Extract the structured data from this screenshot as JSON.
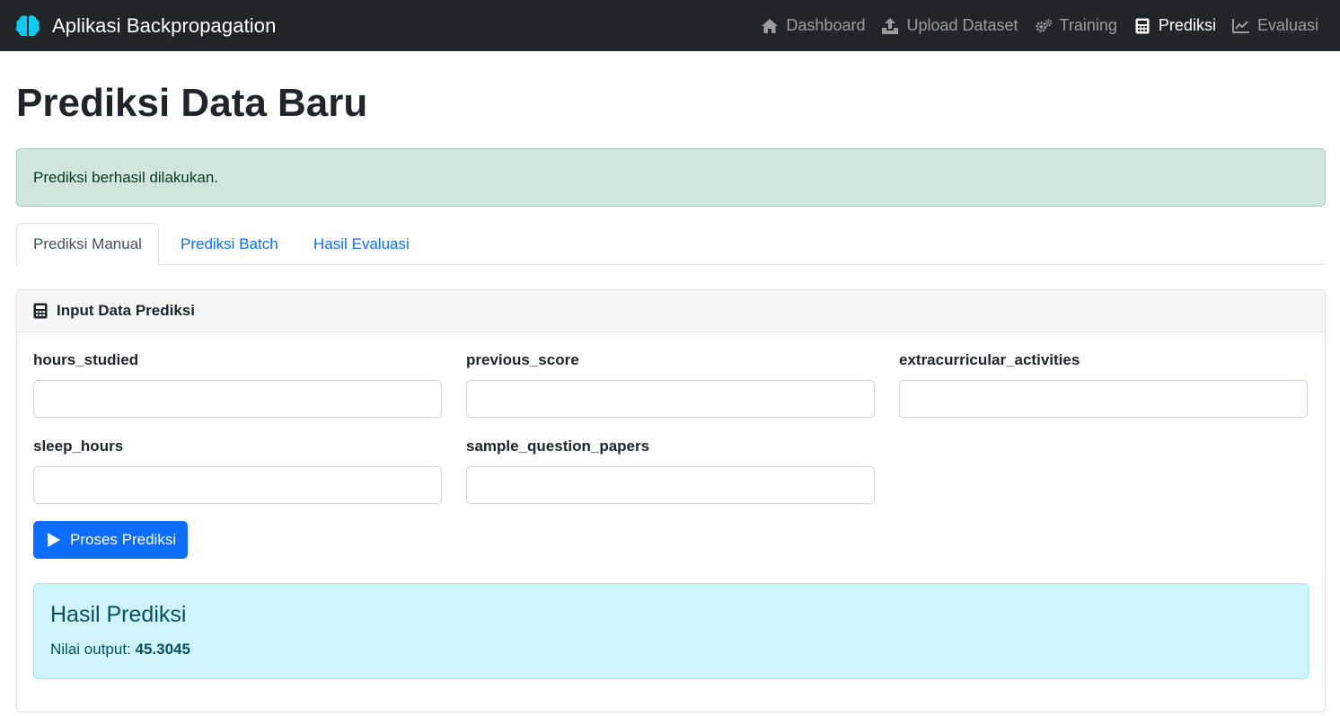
{
  "navbar": {
    "brand": "Aplikasi Backpropagation",
    "links": [
      {
        "label": "Dashboard",
        "icon": "home-icon"
      },
      {
        "label": "Upload Dataset",
        "icon": "upload-icon"
      },
      {
        "label": "Training",
        "icon": "gears-icon"
      },
      {
        "label": "Prediksi",
        "icon": "calculator-icon",
        "active": true
      },
      {
        "label": "Evaluasi",
        "icon": "line-chart-icon"
      }
    ]
  },
  "page": {
    "title": "Prediksi Data Baru"
  },
  "alert": {
    "message": "Prediksi berhasil dilakukan."
  },
  "tabs": [
    {
      "label": "Prediksi Manual",
      "active": true
    },
    {
      "label": "Prediksi Batch"
    },
    {
      "label": "Hasil Evaluasi"
    }
  ],
  "card": {
    "title": "Input Data Prediksi",
    "fields": [
      {
        "label": "hours_studied",
        "value": ""
      },
      {
        "label": "previous_score",
        "value": ""
      },
      {
        "label": "extracurricular_activities",
        "value": ""
      },
      {
        "label": "sleep_hours",
        "value": ""
      },
      {
        "label": "sample_question_papers",
        "value": ""
      }
    ],
    "submit_label": "Proses Prediksi"
  },
  "result": {
    "title": "Hasil Prediksi",
    "output_label": "Nilai output: ",
    "output_value": "45.3045"
  },
  "colors": {
    "navbar_bg": "#212529",
    "brand_icon": "#0dcaf0",
    "primary": "#0d6efd",
    "alert_success_bg": "#d1e7dd",
    "alert_info_bg": "#cff4fc"
  }
}
